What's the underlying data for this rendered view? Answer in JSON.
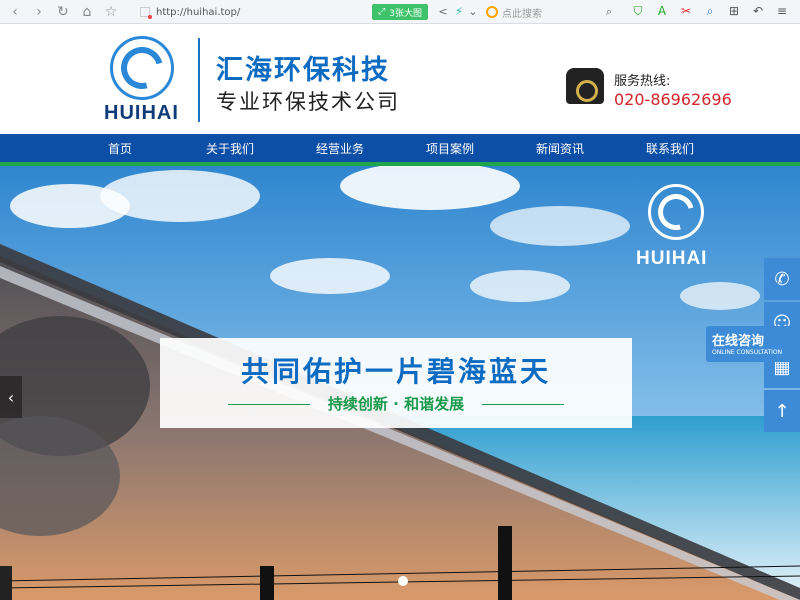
{
  "browser": {
    "url": "http://huihai.top/",
    "big_image_label": "3张大图",
    "search_placeholder": "点此搜索"
  },
  "header": {
    "logo_word": "HUIHAI",
    "company_name": "汇海环保科技",
    "company_subtitle": "专业环保技术公司",
    "hotline_label": "服务热线:",
    "hotline_number": "020-86962696"
  },
  "nav": {
    "items": [
      {
        "label": "首页"
      },
      {
        "label": "关于我们"
      },
      {
        "label": "经营业务"
      },
      {
        "label": "项目案例"
      },
      {
        "label": "新闻资讯"
      },
      {
        "label": "联系我们"
      }
    ]
  },
  "hero": {
    "logo_word": "HUIHAI",
    "headline": "共同佑护一片碧海蓝天",
    "subline": "持续创新 · 和谐发展",
    "slide_count": 1,
    "active_slide": 1
  },
  "sidebar": {
    "consult_label": "在线咨询",
    "consult_sub": "ONLINE CONSULTATION"
  },
  "colors": {
    "brand_blue": "#0d4ea6",
    "accent_green": "#1fa64a",
    "hotline_red": "#d2242a"
  }
}
